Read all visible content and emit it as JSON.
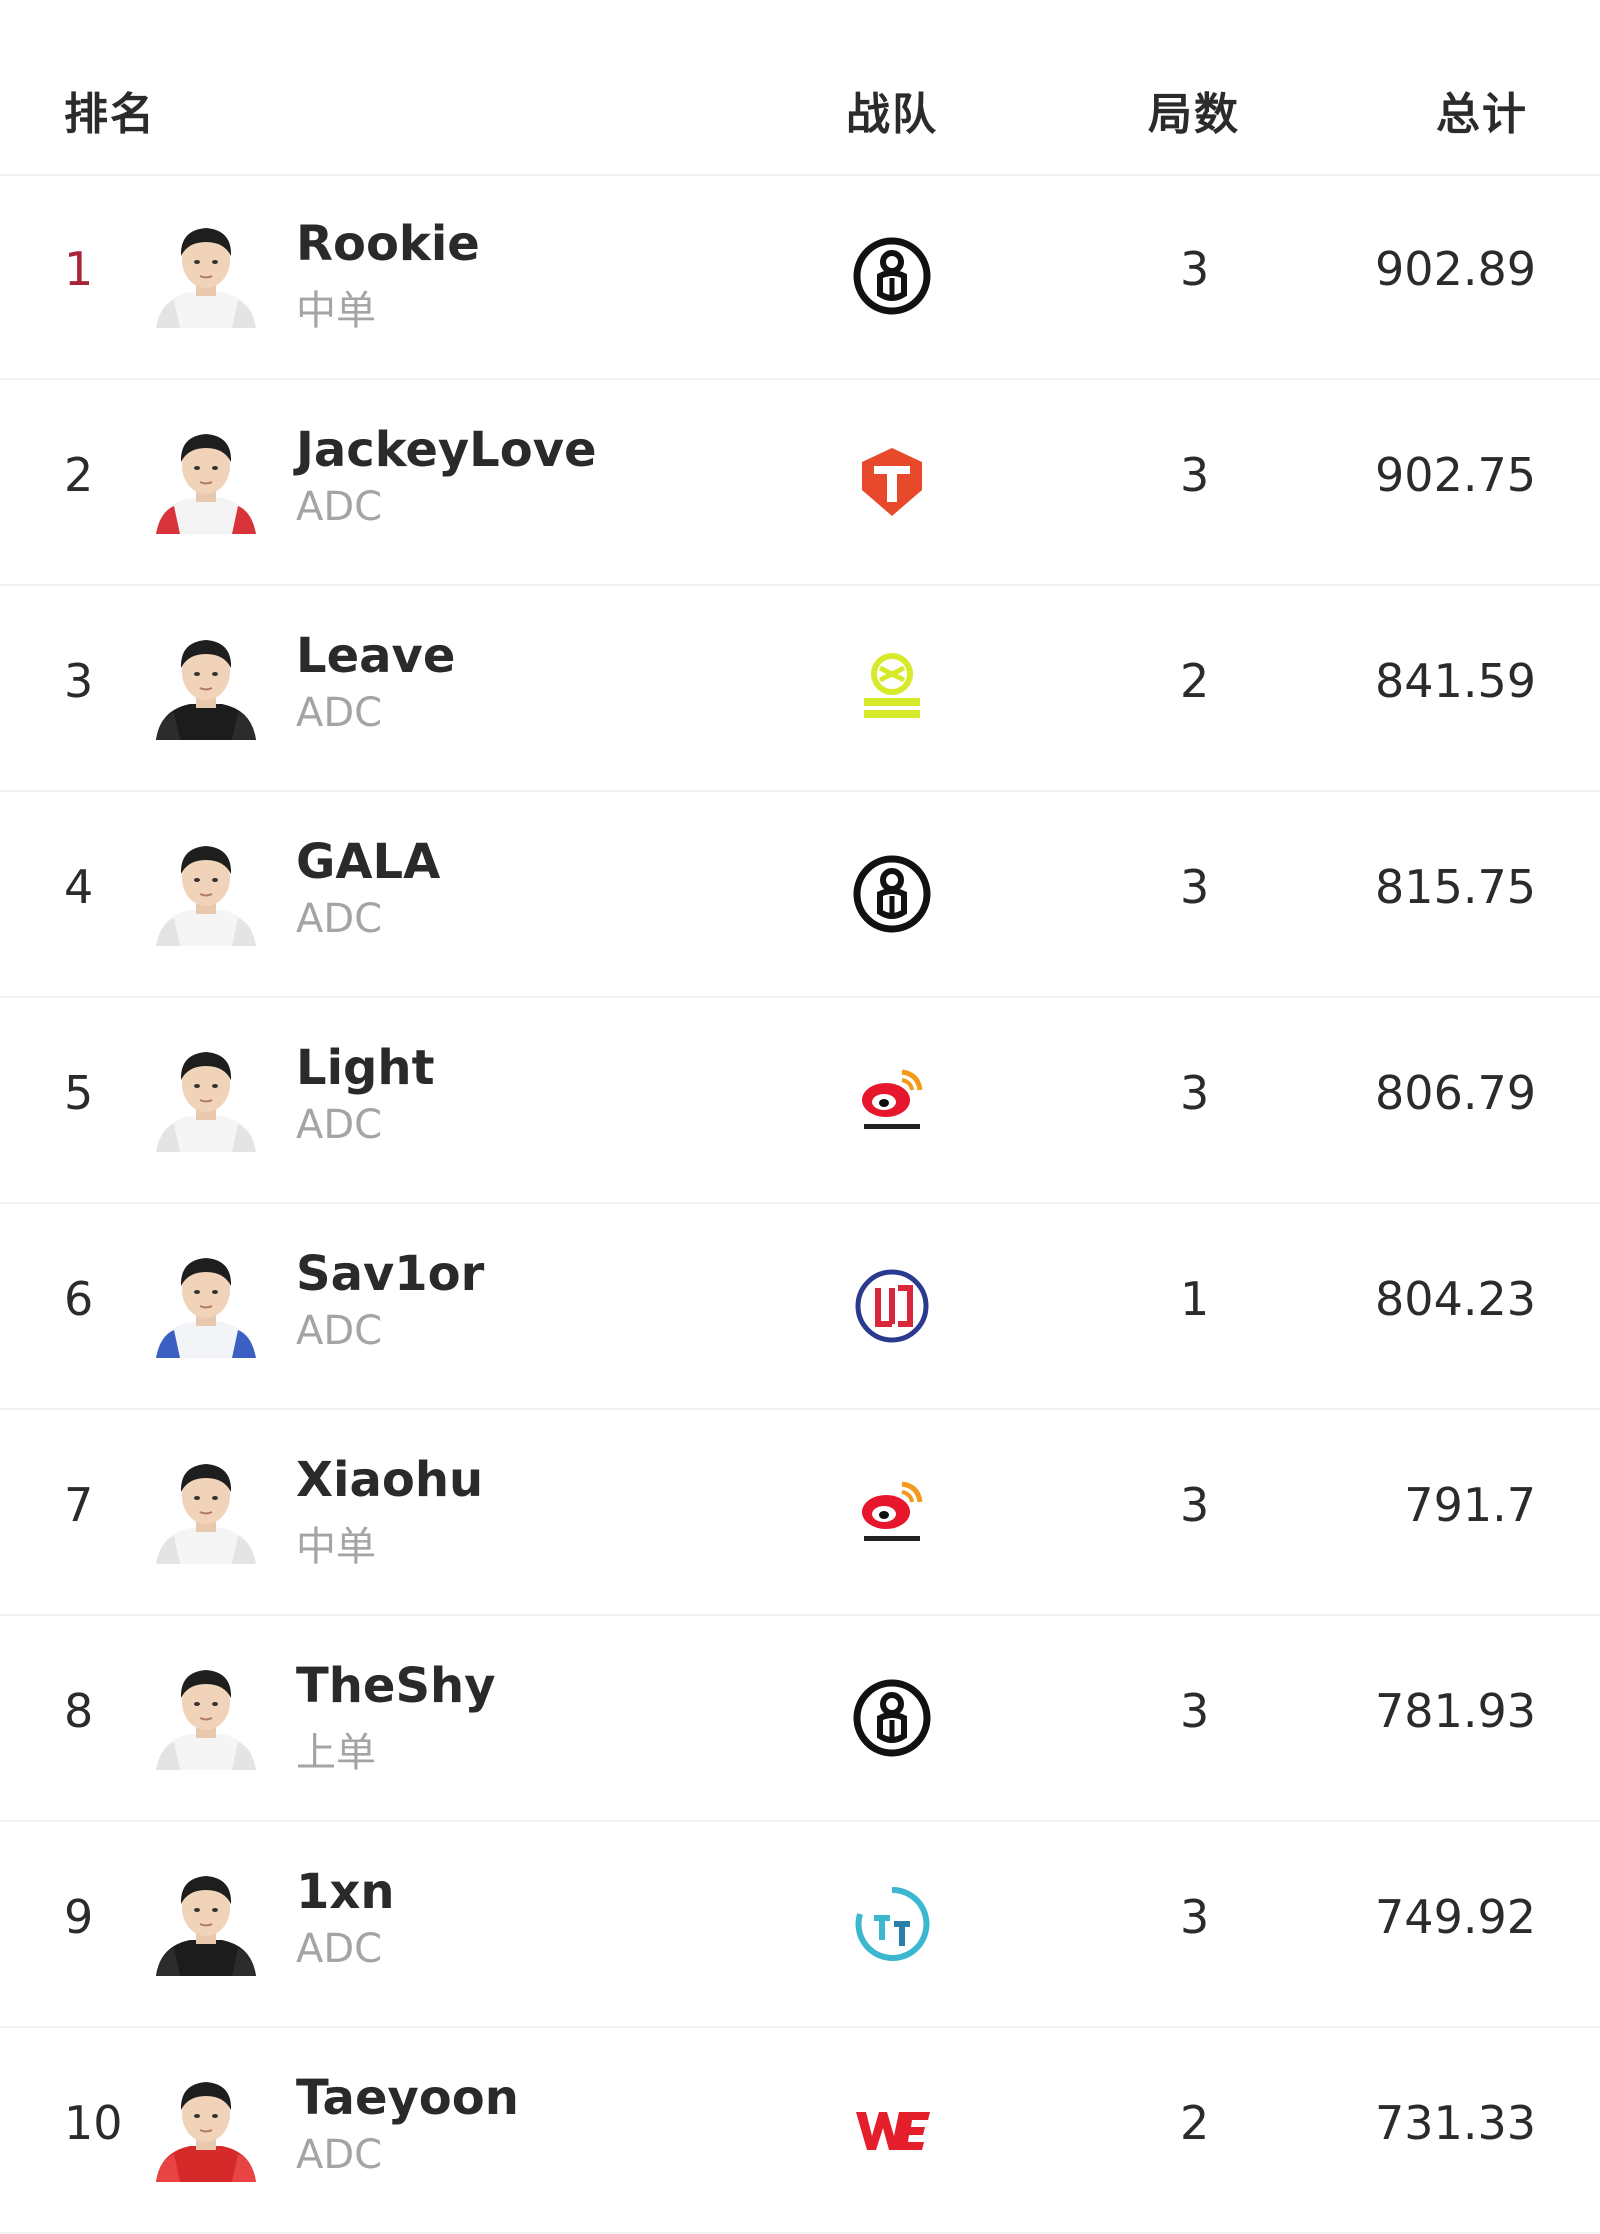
{
  "header": {
    "rank_label": "排名",
    "team_label": "战队",
    "games_label": "局数",
    "total_label": "总计"
  },
  "colors": {
    "top_rank": "#a8243a",
    "role_text": "#a4a4a4"
  },
  "players": [
    {
      "rank": "1",
      "name": "Rookie",
      "role": "中单",
      "team_icon": "ig-logo-icon",
      "games": "3",
      "total": "902.89",
      "jersey": "light"
    },
    {
      "rank": "2",
      "name": "JackeyLove",
      "role": "ADC",
      "team_icon": "tes-logo-icon",
      "games": "3",
      "total": "902.75",
      "jersey": "red-white"
    },
    {
      "rank": "3",
      "name": "Leave",
      "role": "ADC",
      "team_icon": "ninjas-logo-icon",
      "games": "2",
      "total": "841.59",
      "jersey": "dark"
    },
    {
      "rank": "4",
      "name": "GALA",
      "role": "ADC",
      "team_icon": "ig-logo-icon",
      "games": "3",
      "total": "815.75",
      "jersey": "light"
    },
    {
      "rank": "5",
      "name": "Light",
      "role": "ADC",
      "team_icon": "weibo-gaming-logo-icon",
      "games": "3",
      "total": "806.79",
      "jersey": "light"
    },
    {
      "rank": "6",
      "name": "Sav1or",
      "role": "ADC",
      "team_icon": "lgd-logo-icon",
      "games": "1",
      "total": "804.23",
      "jersey": "blue-white"
    },
    {
      "rank": "7",
      "name": "Xiaohu",
      "role": "中单",
      "team_icon": "weibo-gaming-logo-icon",
      "games": "3",
      "total": "791.7",
      "jersey": "light"
    },
    {
      "rank": "8",
      "name": "TheShy",
      "role": "上单",
      "team_icon": "ig-logo-icon",
      "games": "3",
      "total": "781.93",
      "jersey": "light"
    },
    {
      "rank": "9",
      "name": "1xn",
      "role": "ADC",
      "team_icon": "tt-logo-icon",
      "games": "3",
      "total": "749.92",
      "jersey": "dark"
    },
    {
      "rank": "10",
      "name": "Taeyoon",
      "role": "ADC",
      "team_icon": "we-logo-icon",
      "games": "2",
      "total": "731.33",
      "jersey": "red"
    }
  ]
}
